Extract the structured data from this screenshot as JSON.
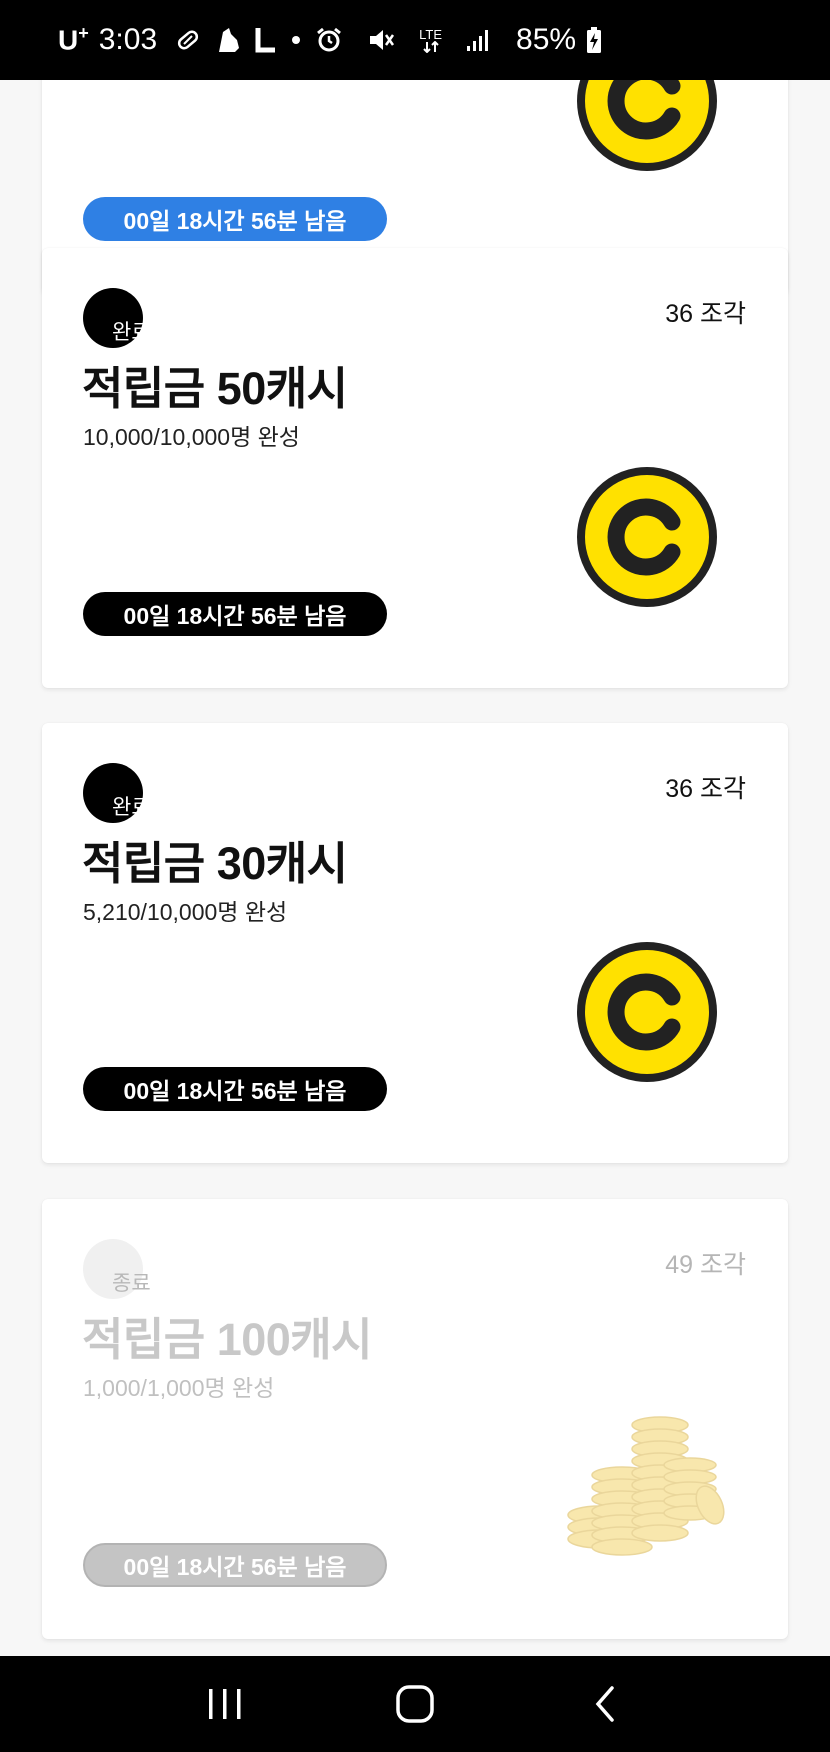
{
  "status_bar": {
    "carrier": "U",
    "carrier_sup": "+",
    "time": "3:03",
    "network": "LTE",
    "battery": "85%"
  },
  "cards": [
    {
      "timer": "00일 18시간 56분 남음",
      "timer_color": "#2f80e4",
      "icon": "coin-icon"
    },
    {
      "status": "완료",
      "pieces": "36 조각",
      "title": "적립금 50캐시",
      "progress": "10,000/10,000명 완성",
      "timer": "00일 18시간 56분 남음",
      "icon": "coin-icon"
    },
    {
      "status": "완료",
      "pieces": "36 조각",
      "title": "적립금 30캐시",
      "progress": "5,210/10,000명 완성",
      "timer": "00일 18시간 56분 남음",
      "icon": "coin-icon"
    },
    {
      "status": "종료",
      "pieces": "49 조각",
      "title": "적립금 100캐시",
      "progress": "1,000/1,000명 완성",
      "timer": "00일 18시간 56분 남음",
      "icon": "coin-stack-icon"
    }
  ],
  "colors": {
    "coin_fill": "#ffe100",
    "coin_stroke": "#222222",
    "timer_active": "#000000",
    "timer_disabled": "#c4c4c4"
  },
  "nav": {
    "recent": "recent-apps-icon",
    "home": "home-icon",
    "back": "back-icon"
  }
}
